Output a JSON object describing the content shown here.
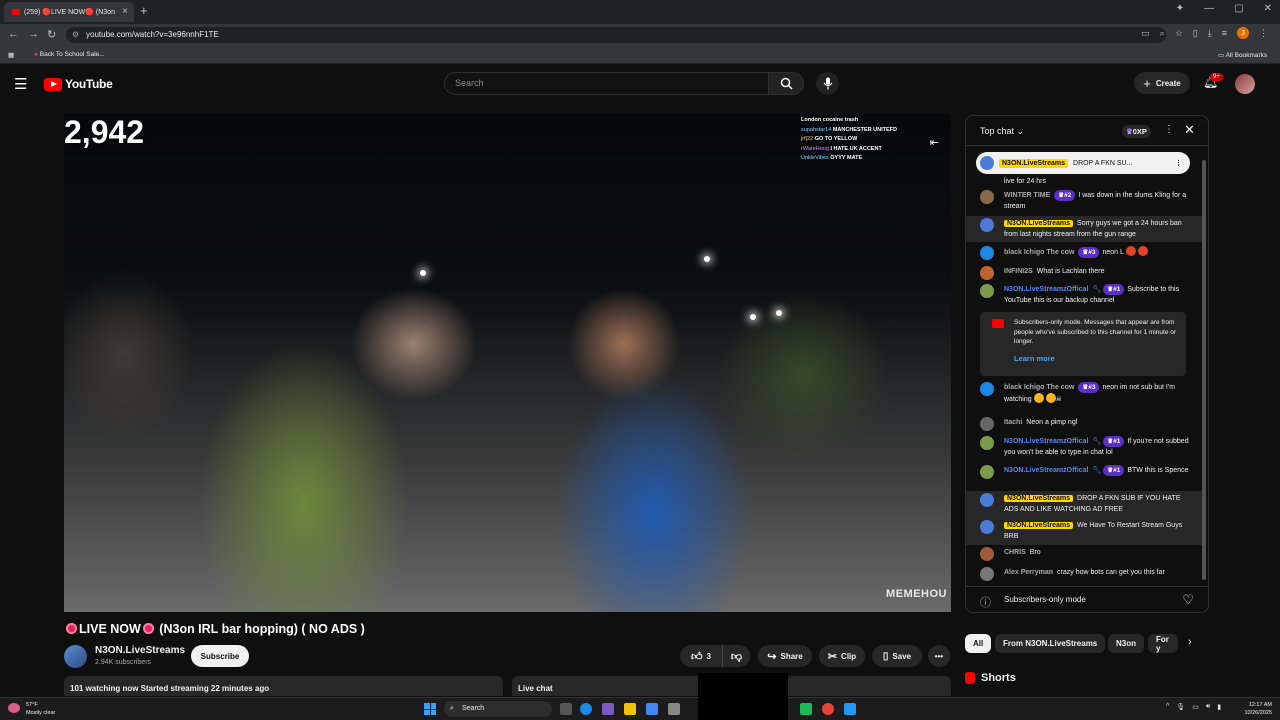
{
  "browser": {
    "tab_title": "(259) 🔴LIVE NOW🔴 (N3on",
    "url": "youtube.com/watch?v=3e96nnhF1TE",
    "bookmark_item": "Back To School Sale...",
    "all_bookmarks": "All Bookmarks",
    "profile_initial": "J"
  },
  "header": {
    "logo_text": "YouTube",
    "search_placeholder": "Search",
    "create_label": "Create",
    "notif_badge": "9+"
  },
  "video": {
    "view_count": "2,942",
    "overlay_chat": [
      {
        "user": "",
        "text": "London cocaine trash"
      },
      {
        "user": "supahstar14",
        "text": "MANCHESTER UNITEFD"
      },
      {
        "user": "jrf|22",
        "text": "GO TO YELLOW"
      },
      {
        "user": "rWareHong",
        "text": "I HATE UK ACCENT"
      },
      {
        "user": "UnkleVibes",
        "text": "OYYY MATE"
      }
    ],
    "watermark": "MEMEHOU"
  },
  "info": {
    "title": "LIVE NOW",
    "title_rest": "(N3on IRL bar hopping) ( NO ADS )",
    "channel_name": "N3ON.LiveStreams",
    "subscribers": "2.94K subscribers",
    "subscribe_label": "Subscribe",
    "likes": "3",
    "share_label": "Share",
    "clip_label": "Clip",
    "save_label": "Save",
    "watching": "101 watching now  Started streaming 22 minutes ago",
    "live_chat_label": "Live chat"
  },
  "chat": {
    "header_label": "Top chat",
    "points": "0XP",
    "pinned_user": "N3ON.LiveStreams",
    "pinned_text": "DROP A FKN SU...",
    "messages": [
      {
        "name": "",
        "text": "live for 24 hrs"
      },
      {
        "name": "WINTER TIME",
        "rank": "#2",
        "text": "I was down in the slums Kling for a stream"
      },
      {
        "name": "N3ON.LiveStreams",
        "text": "Sorry guys we got a 24 hours ban from last nights stream from the gun range"
      },
      {
        "name": "black Ichigo The cow",
        "rank": "#3",
        "text": "neon L"
      },
      {
        "name": "INFINI2S",
        "text": "What is Lachlan there"
      },
      {
        "name": "N3ON.LiveStreamzOffical",
        "rank": "#1",
        "text": "Subscribe to this YouTube this is our backup channel"
      },
      {
        "name": "black Ichigo The cow",
        "rank": "#3",
        "text": "neon im not sub but I'm watching"
      },
      {
        "name": "Itachi",
        "text": "Neon a pimp ngl"
      },
      {
        "name": "N3ON.LiveStreamzOffical",
        "rank": "#1",
        "text": "If you're not subbed you won't be able to type in chat lol"
      },
      {
        "name": "N3ON.LiveStreamzOffical",
        "rank": "#1",
        "text": "BTW this is Spence"
      },
      {
        "name": "N3ON.LiveStreams",
        "text": "DROP A FKN SUB IF YOU HATE ADS AND LIKE WATCHING AD FREE"
      },
      {
        "name": "N3ON.LiveStreams",
        "text": "We Have To Restart Stream Guys BRB"
      },
      {
        "name": "CHRIS",
        "text": "Bro"
      },
      {
        "name": "Alex Perryman",
        "text": "crazy how bots can get you this far"
      }
    ],
    "notice_text": "Subscribers-only mode. Messages that appear are from people who've subscribed to this channel for 1 minute or longer.",
    "learn_more": "Learn more",
    "footer_mode": "Subscribers-only mode"
  },
  "chips": [
    "All",
    "From N3ON.LiveStreams",
    "N3on",
    "For y"
  ],
  "shorts_label": "Shorts",
  "taskbar": {
    "temp": "57°F",
    "weather": "Mostly clear",
    "search_label": "Search",
    "time": "12:17 AM",
    "date": "10/26/2025"
  },
  "colors": {
    "accent_red": "#ff0000",
    "highlight_yellow": "#ffd600",
    "link_blue": "#3ea6ff",
    "rank_purple": "#5b2fc4"
  }
}
